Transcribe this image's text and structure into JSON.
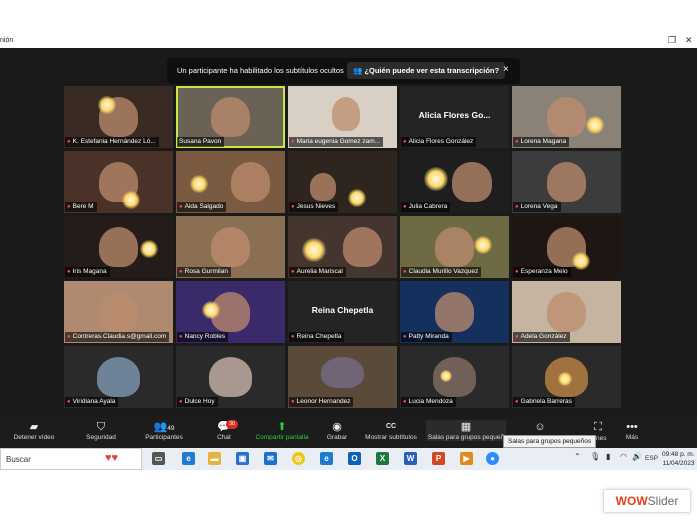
{
  "window": {
    "title": "nión",
    "restore_icon": "restore-icon",
    "close_icon": "close-icon"
  },
  "banner": {
    "text": "Un participante ha habilitado los subtítulos ocultos",
    "link": "¿Quién puede ver esta transcripción?",
    "close": "×"
  },
  "participants": [
    {
      "name": "K. Estefania Hernández Ló..."
    },
    {
      "name": "Susana Pavon"
    },
    {
      "name": "Maria eugenia Gomez zam..."
    },
    {
      "name": "Alicia Flores González",
      "display_name": "Alicia Flores Go..."
    },
    {
      "name": "Lorena Magana"
    },
    {
      "name": "Bere M"
    },
    {
      "name": "Aida Salgado"
    },
    {
      "name": "Jesus Nieves"
    },
    {
      "name": "Julia Cabrera"
    },
    {
      "name": "Lorena Vega"
    },
    {
      "name": "Iris Magana"
    },
    {
      "name": "Rosa Gurmilan"
    },
    {
      "name": "Aurelia Mariscal"
    },
    {
      "name": "Claudia Murillo Vazquez"
    },
    {
      "name": "Esperanza Melo"
    },
    {
      "name": "Contreras.Claudia.s@gmail.com"
    },
    {
      "name": "Nancy Robles"
    },
    {
      "name": "Reina Chepetla",
      "display_name": "Reina Chepetla"
    },
    {
      "name": "Patty Miranda"
    },
    {
      "name": "Adela González"
    },
    {
      "name": "Viridiana Ayala"
    },
    {
      "name": "Dulce Hoy"
    },
    {
      "name": "Leonor Hernandez"
    },
    {
      "name": "Lucia Mendoza"
    },
    {
      "name": "Gabriela Barreras"
    }
  ],
  "toolbar": {
    "items": [
      {
        "label": "Detener vídeo",
        "icon": "video-camera-icon"
      },
      {
        "label": "Seguridad",
        "icon": "shield-icon"
      },
      {
        "label": "Participantes",
        "icon": "people-icon",
        "count": "49"
      },
      {
        "label": "Chat",
        "icon": "chat-icon",
        "badge": "30"
      },
      {
        "label": "Compartir pantalla",
        "icon": "share-screen-icon"
      },
      {
        "label": "Grabar",
        "icon": "record-icon"
      },
      {
        "label": "Mostrar subtítulos",
        "icon": "cc-icon"
      },
      {
        "label": "Salas para grupos pequeñ",
        "icon": "breakout-rooms-icon"
      },
      {
        "label": "nes",
        "icon": "reactions-icon"
      },
      {
        "label": "",
        "icon": "whiteboard-icon"
      },
      {
        "label": "Más",
        "icon": "more-icon"
      }
    ],
    "tooltip": "Salas para grupos pequeños"
  },
  "taskbar": {
    "search_placeholder": "Buscar",
    "tray": {
      "lang": "ESP",
      "time": "09:48 p. m.",
      "date": "11/04/2023"
    }
  },
  "watermark": {
    "part1": "WOW",
    "part2": "Slider"
  },
  "colors": {
    "accent_green": "#2ecc40",
    "speaking_border": "#c7e84a",
    "mute_red": "#ff4d4d"
  }
}
